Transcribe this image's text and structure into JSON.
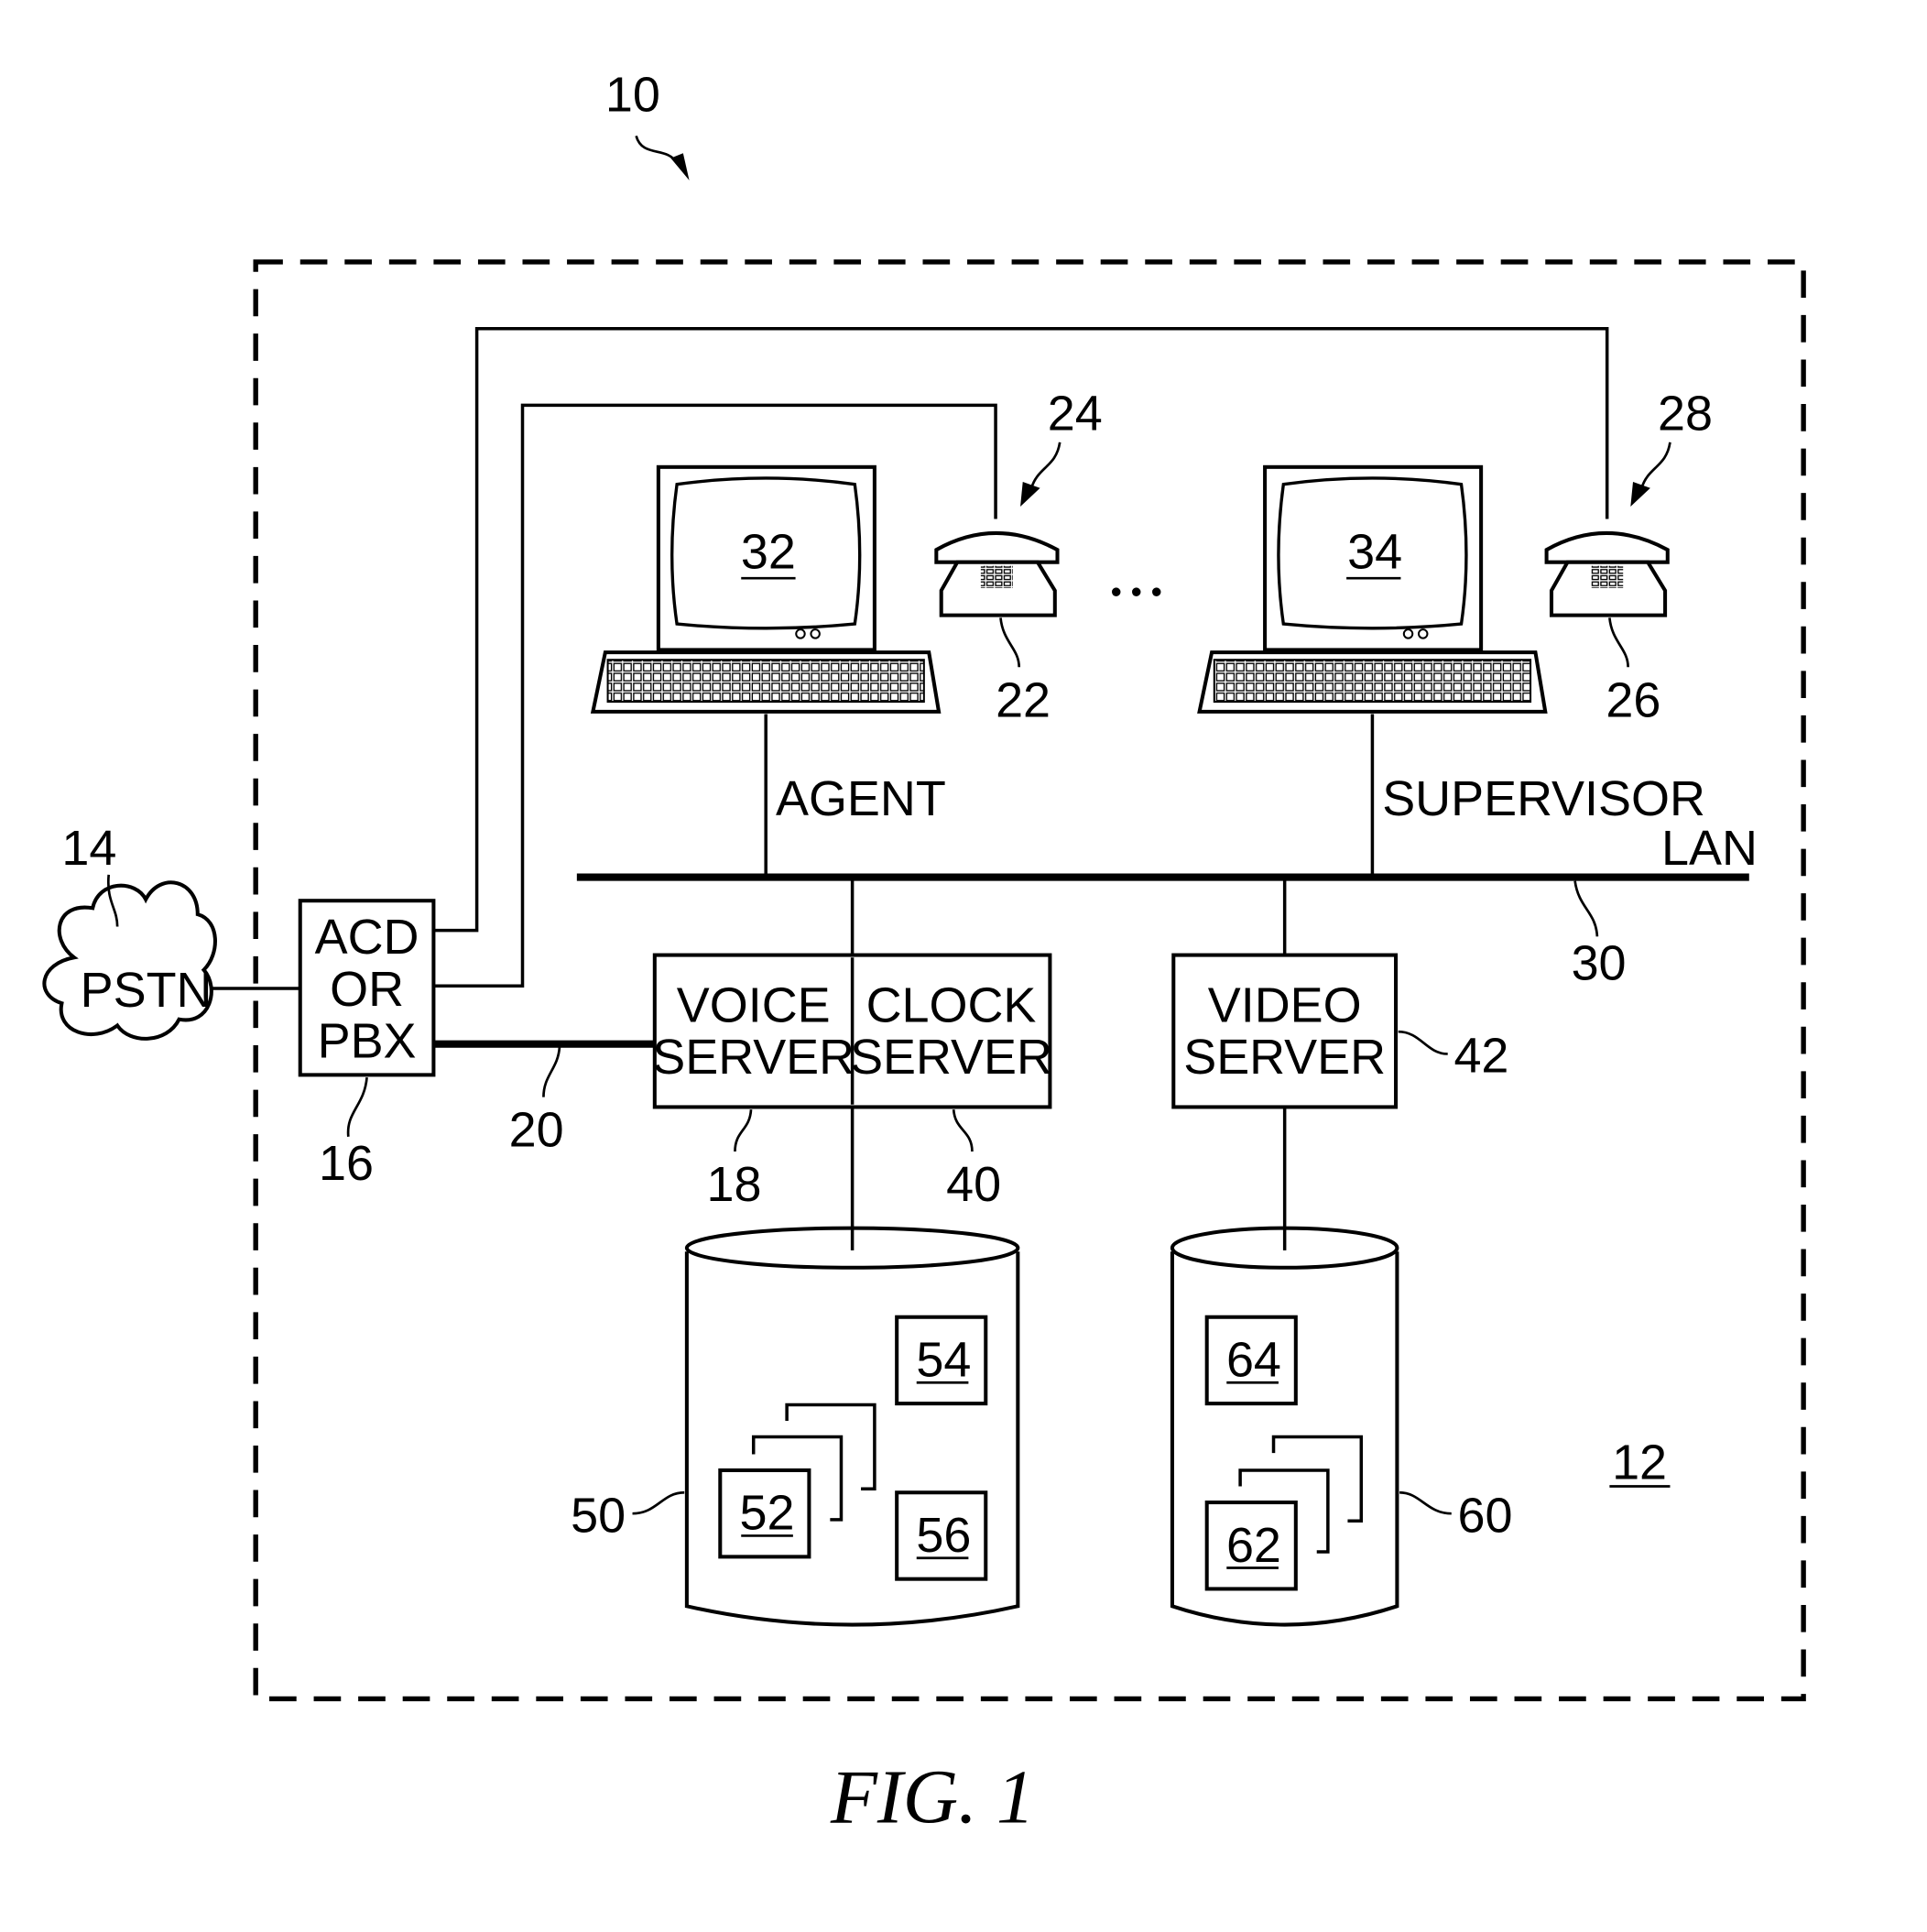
{
  "figure": {
    "caption": "FIG. 1",
    "system_ref": "10",
    "boundary_ref": "12"
  },
  "network": {
    "pstn": {
      "label": "PSTN",
      "ref": "14"
    },
    "acd": {
      "lines": [
        "ACD",
        "OR",
        "PBX"
      ],
      "ref": "16"
    },
    "trunk_ref": "20",
    "lan": {
      "label": "LAN",
      "ref": "30"
    }
  },
  "stations": {
    "agent": {
      "label": "AGENT",
      "workstation_ref": "32",
      "phone_ref": "22",
      "station_ref": "24"
    },
    "supervisor": {
      "label": "SUPERVISOR",
      "workstation_ref": "34",
      "phone_ref": "26",
      "station_ref": "28"
    },
    "ellipsis": "• • •"
  },
  "servers": {
    "voice": {
      "lines": [
        "VOICE",
        "SERVER"
      ],
      "ref": "18"
    },
    "clock": {
      "lines": [
        "CLOCK",
        "SERVER"
      ],
      "ref": "40"
    },
    "video": {
      "lines": [
        "VIDEO",
        "SERVER"
      ],
      "ref": "42"
    }
  },
  "storage": {
    "voice_db": {
      "ref": "50",
      "items": {
        "stack": "52",
        "top": "54",
        "bottom": "56"
      }
    },
    "video_db": {
      "ref": "60",
      "items": {
        "top": "64",
        "stack": "62"
      }
    }
  }
}
